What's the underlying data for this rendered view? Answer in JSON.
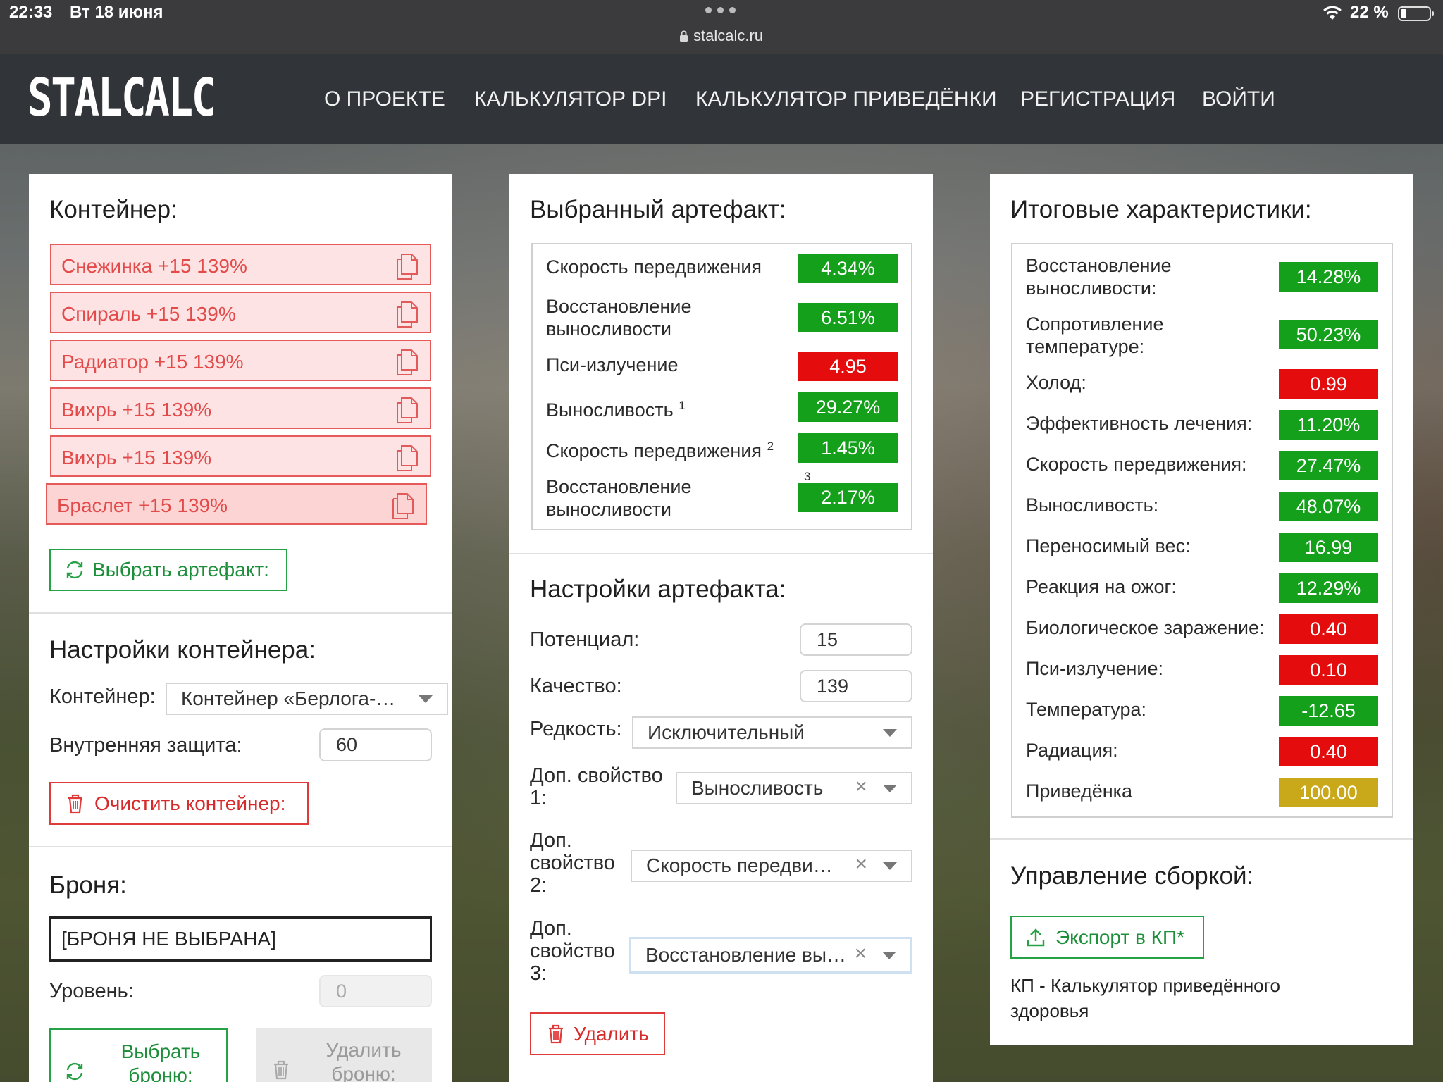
{
  "status_bar": {
    "time": "22:33",
    "date": "Вт 18 июня",
    "url": "stalcalc.ru",
    "battery": "22 %"
  },
  "nav": {
    "logo": "STALCALC",
    "items": [
      "О ПРОЕКТЕ",
      "КАЛЬКУЛЯТОР DPI",
      "КАЛЬКУЛЯТОР ПРИВЕДЁНКИ",
      "РЕГИСТРАЦИЯ",
      "ВОЙТИ"
    ]
  },
  "container_panel": {
    "title": "Контейнер:",
    "artifacts": [
      "Снежинка +15 139%",
      "Спираль +15 139%",
      "Радиатор +15 139%",
      "Вихрь +15 139%",
      "Вихрь +15 139%",
      "Браслет +15 139%"
    ],
    "select_artifact_button": "Выбрать артефакт:",
    "settings_title": "Настройки контейнера:",
    "container_label": "Контейнер:",
    "container_value": "Контейнер «Берлога-…",
    "inner_protection_label": "Внутренняя защита:",
    "inner_protection_value": "60",
    "clear_button": "Очистить контейнер:",
    "armor_title": "Броня:",
    "armor_value": "[БРОНЯ НЕ ВЫБРАНА]",
    "level_label": "Уровень:",
    "level_value": "0",
    "select_armor_button": "Выбрать броню:",
    "remove_armor_button": "Удалить броню:"
  },
  "artifact_panel": {
    "title": "Выбранный артефакт:",
    "stats": [
      {
        "label": "Скорость передвижения",
        "sup": "",
        "value": "4.34%",
        "color": "#15a01c"
      },
      {
        "label": "Восстановление выносливости",
        "sup": "",
        "value": "6.51%",
        "color": "#15a01c"
      },
      {
        "label": "Пси-излучение",
        "sup": "",
        "value": "4.95",
        "color": "#e40c0c"
      },
      {
        "label": "Выносливость",
        "sup": "1",
        "value": "29.27%",
        "color": "#15a01c"
      },
      {
        "label": "Скорость передвижения",
        "sup": "2",
        "value": "1.45%",
        "color": "#15a01c"
      },
      {
        "label": "Восстановление выносливости",
        "sup": "3",
        "value": "2.17%",
        "color": "#15a01c"
      }
    ],
    "settings_title": "Настройки артефакта:",
    "potential_label": "Потенциал:",
    "potential_value": "15",
    "quality_label": "Качество:",
    "quality_value": "139",
    "rarity_label": "Редкость:",
    "rarity_value": "Исключительный",
    "prop1_label": "Доп. свойство 1:",
    "prop1_value": "Выносливость",
    "prop2_label": "Доп. свойство 2:",
    "prop2_value": "Скорость передви…",
    "prop3_label": "Доп. свойство 3:",
    "prop3_value": "Восстановление вы…",
    "delete_button": "Удалить"
  },
  "totals_panel": {
    "title": "Итоговые характеристики:",
    "stats": [
      {
        "label": "Восстановление выносливости:",
        "value": "14.28%",
        "color": "#15a01c"
      },
      {
        "label": "Сопротивление температуре:",
        "value": "50.23%",
        "color": "#15a01c"
      },
      {
        "label": "Холод:",
        "value": "0.99",
        "color": "#e40c0c"
      },
      {
        "label": "Эффективность лечения:",
        "value": "11.20%",
        "color": "#15a01c"
      },
      {
        "label": "Скорость передвижения:",
        "value": "27.47%",
        "color": "#15a01c"
      },
      {
        "label": "Выносливость:",
        "value": "48.07%",
        "color": "#15a01c"
      },
      {
        "label": "Переносимый вес:",
        "value": "16.99",
        "color": "#15a01c"
      },
      {
        "label": "Реакция на ожог:",
        "value": "12.29%",
        "color": "#15a01c"
      },
      {
        "label": "Биологическое заражение:",
        "value": "0.40",
        "color": "#e40c0c"
      },
      {
        "label": "Пси-излучение:",
        "value": "0.10",
        "color": "#e40c0c"
      },
      {
        "label": "Температура:",
        "value": "-12.65",
        "color": "#15a01c"
      },
      {
        "label": "Радиация:",
        "value": "0.40",
        "color": "#e40c0c"
      },
      {
        "label": "Приведёнка",
        "value": "100.00",
        "color": "#c9a81a"
      }
    ],
    "build_title": "Управление сборкой:",
    "export_button": "Экспорт в КП*",
    "footnote": "КП - Калькулятор приведённого здоровья"
  },
  "icons": {
    "copy": "copy-icon",
    "refresh": "refresh-icon",
    "trash": "trash-icon",
    "upload": "upload-icon",
    "lock": "lock-icon",
    "wifi": "wifi-icon",
    "dropdown": "chevron-down-icon",
    "clear": "close-icon"
  }
}
